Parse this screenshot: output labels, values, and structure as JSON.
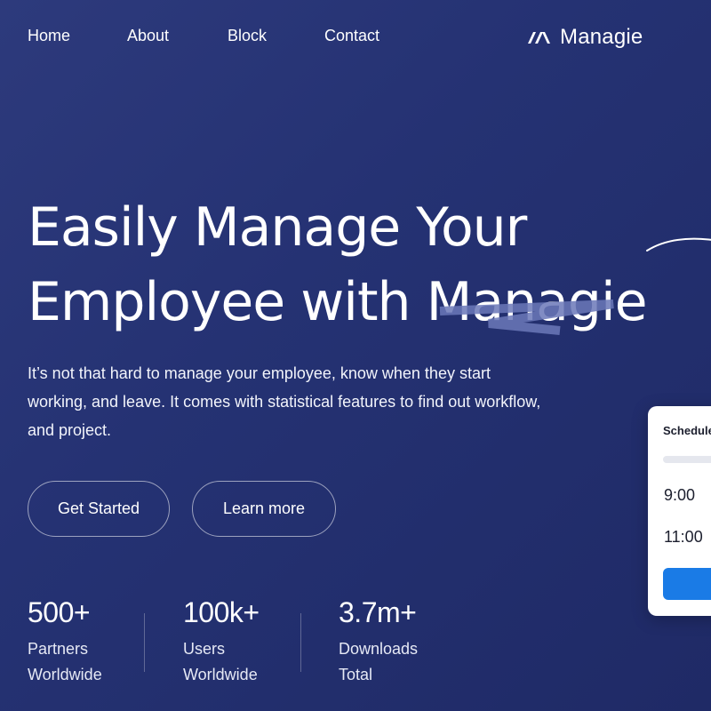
{
  "nav": {
    "items": [
      {
        "label": "Home"
      },
      {
        "label": "About"
      },
      {
        "label": "Block"
      },
      {
        "label": "Contact"
      }
    ]
  },
  "brand": {
    "name": "Managie",
    "icon": "chevrons-logo-icon"
  },
  "hero": {
    "headline_line1": "Easily Manage Your",
    "headline_line2": "Employee with Managie",
    "description": "It’s not that hard to manage your employee, know when they start working, and leave. It comes with statistical features to find out workflow, and project."
  },
  "buttons": {
    "primary_label": "Get Started",
    "secondary_label": "Learn more"
  },
  "stats": [
    {
      "value": "500+",
      "label_line1": "Partners",
      "label_line2": "Worldwide"
    },
    {
      "value": "100k+",
      "label_line1": "Users",
      "label_line2": "Worldwide"
    },
    {
      "value": "3.7m+",
      "label_line1": "Downloads",
      "label_line2": "Total"
    }
  ],
  "schedule_card": {
    "title": "Schedule",
    "times": [
      "9:00",
      "11:00"
    ]
  },
  "colors": {
    "background": "#27337a",
    "accent": "#1a7be6",
    "scribble": "#6b78b8"
  }
}
